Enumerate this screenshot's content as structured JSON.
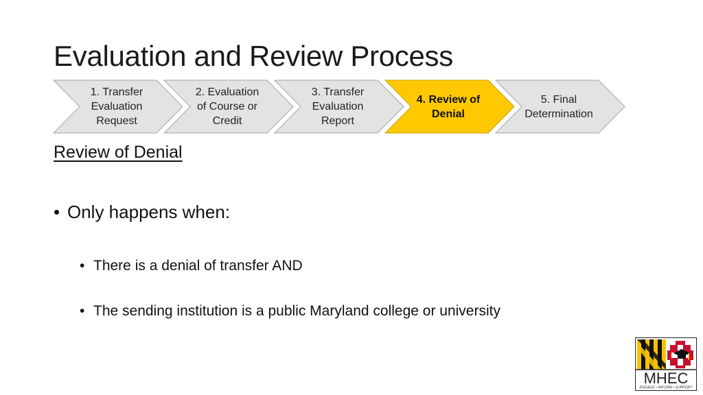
{
  "slide": {
    "title": "Evaluation and Review Process",
    "process_steps": [
      {
        "label_lines": [
          "1. Transfer",
          "Evaluation",
          "Request"
        ],
        "active": false
      },
      {
        "label_lines": [
          "2. Evaluation",
          "of Course or",
          "Credit"
        ],
        "active": false
      },
      {
        "label_lines": [
          "3. Transfer",
          "Evaluation",
          "Report"
        ],
        "active": false
      },
      {
        "label_lines": [
          "4. Review of",
          "Denial"
        ],
        "active": true
      },
      {
        "label_lines": [
          "5. Final",
          "Determination"
        ],
        "active": false
      }
    ],
    "colors": {
      "step_fill": "#e3e3e3",
      "step_border": "#a6a6a6",
      "active_fill": "#ffc800",
      "active_border": "#c9a000"
    },
    "subheading": "Review of Denial",
    "bullets": [
      {
        "text": "Only happens when:",
        "sub_bullets": [
          "There is a denial of transfer AND",
          "The sending institution is a public Maryland college or university"
        ]
      }
    ],
    "bullet_glyph": "•",
    "logo": {
      "text": "MHEC",
      "tagline": "ENGAGE • INFORM • SUPPORT"
    }
  }
}
